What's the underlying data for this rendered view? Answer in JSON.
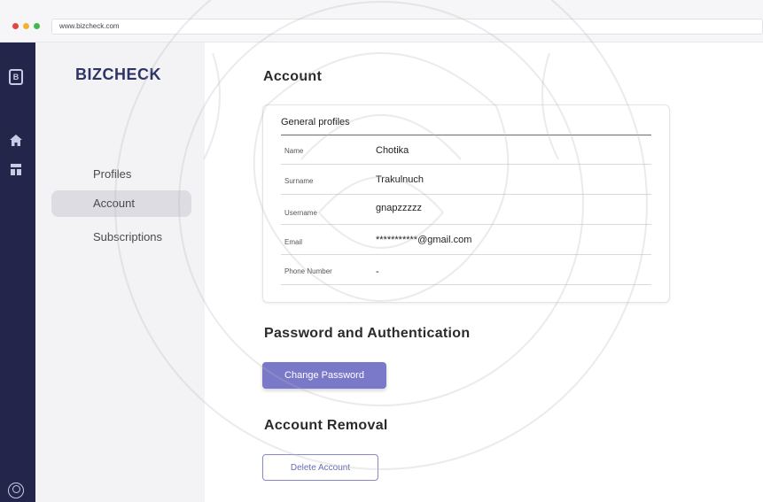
{
  "browser": {
    "url": "www.bizcheck.com",
    "dot_colors": [
      "#e2473f",
      "#f2b233",
      "#44b94b"
    ]
  },
  "rail": {
    "icons": [
      "logo-icon",
      "home-icon",
      "dashboard-icon",
      "user-circle-icon"
    ],
    "logo_letter": "B"
  },
  "sidebar": {
    "brand": "BIZCHECK",
    "items": [
      {
        "label": "Profiles",
        "active": false
      },
      {
        "label": "Account",
        "active": true
      },
      {
        "label": "Subscriptions",
        "active": false
      }
    ]
  },
  "account": {
    "title": "Account",
    "card_title": "General profiles",
    "fields": [
      {
        "label": "Name",
        "value": "Chotika"
      },
      {
        "label": "Surname",
        "value": "Trakulnuch"
      },
      {
        "label": "Username",
        "value": "gnapzzzzz"
      },
      {
        "label": "Email",
        "value": "***********@gmail.com"
      },
      {
        "label": "Phone Number",
        "value": "-"
      }
    ]
  },
  "password": {
    "title": "Password and Authentication",
    "button": "Change Password"
  },
  "removal": {
    "title": "Account Removal",
    "button": "Delete Account"
  },
  "colors": {
    "accent": "#7a78c8",
    "rail": "#23264a",
    "brand": "#2f3466"
  }
}
